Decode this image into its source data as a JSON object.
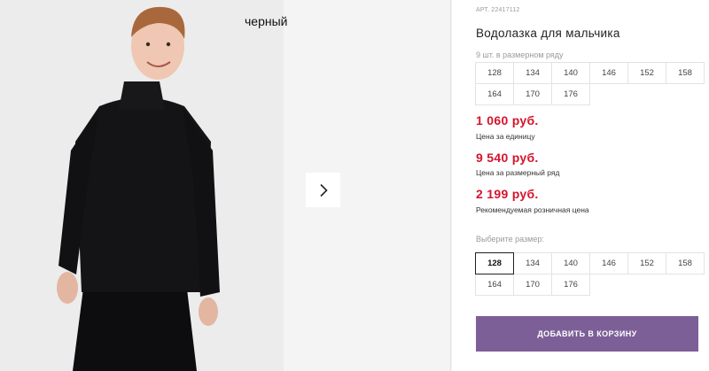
{
  "gallery": {
    "color_label": "черный",
    "next_icon": "chevron-right-icon"
  },
  "product": {
    "article_label": "АРТ.",
    "article": "22417112",
    "title": "Водолазка для мальчика",
    "row_note": "9 шт. в размерном ряду",
    "row_sizes": [
      "128",
      "134",
      "140",
      "146",
      "152",
      "158",
      "164",
      "170",
      "176"
    ]
  },
  "prices": {
    "unit_price": "1 060 руб.",
    "unit_caption": "Цена за единицу",
    "row_price": "9 540 руб.",
    "row_caption": "Цена за размерный ряд",
    "retail_price": "2 199 руб.",
    "retail_caption": "Рекомендуемая розничная цена"
  },
  "size_select": {
    "label": "Выберите размер:",
    "sizes": [
      "128",
      "134",
      "140",
      "146",
      "152",
      "158",
      "164",
      "170",
      "176"
    ],
    "selected": "128"
  },
  "cart": {
    "button_label": "ДОБАВИТЬ В КОРЗИНУ"
  },
  "colors": {
    "price_red": "#d5142c",
    "button_purple": "#7d5f98",
    "sweater": "#141416"
  }
}
